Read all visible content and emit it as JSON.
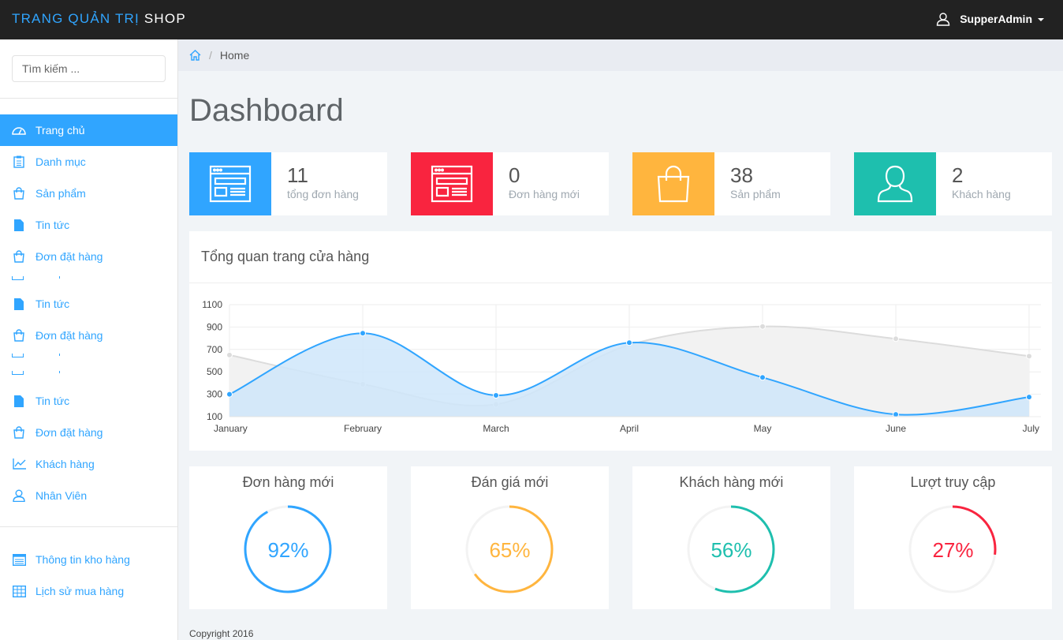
{
  "navbar": {
    "brand_part1": "TRANG QUẢN TRỊ",
    "brand_part2": "SHOP",
    "user_name": "SupperAdmin"
  },
  "sidebar": {
    "search_placeholder": "Tìm kiếm ...",
    "items": [
      {
        "label": "Trang chủ",
        "icon": "dashboard-icon",
        "active": true
      },
      {
        "label": "Danh mục",
        "icon": "clipboard-icon"
      },
      {
        "label": "Sản phẩm",
        "icon": "shopping-bag-icon"
      },
      {
        "label": "Tin tức",
        "icon": "file-icon"
      },
      {
        "label": "Đơn đặt hàng",
        "icon": "shopping-bag-icon"
      },
      {
        "label": "Tin tức",
        "icon": "file-icon"
      },
      {
        "label": "Đơn đặt hàng",
        "icon": "shopping-bag-icon"
      },
      {
        "label": "Tin tức",
        "icon": "file-icon"
      },
      {
        "label": "Đơn đặt hàng",
        "icon": "shopping-bag-icon"
      },
      {
        "label": "Khách hàng",
        "icon": "line-chart-icon"
      },
      {
        "label": "Nhân Viên",
        "icon": "user-icon"
      }
    ],
    "bottom_items": [
      {
        "label": "Thông tin kho hàng",
        "icon": "warehouse-list-icon"
      },
      {
        "label": "Lịch sử mua hàng",
        "icon": "table-icon"
      }
    ]
  },
  "breadcrumb": {
    "home_icon": "home-icon",
    "current": "Home"
  },
  "page_title": "Dashboard",
  "stats": [
    {
      "value": "11",
      "label": "tổng đơn hàng",
      "color": "#30a5ff",
      "icon": "browser-window-icon"
    },
    {
      "value": "0",
      "label": "Đơn hàng mới",
      "color": "#f9243f",
      "icon": "browser-window-icon"
    },
    {
      "value": "38",
      "label": "Sản phẩm",
      "color": "#ffb53e",
      "icon": "shopping-bag-icon"
    },
    {
      "value": "2",
      "label": "Khách hàng",
      "color": "#1ebfae",
      "icon": "user-icon"
    }
  ],
  "overview": {
    "title": "Tổng quan trang cửa hàng"
  },
  "chart_data": {
    "type": "area",
    "x": [
      "January",
      "February",
      "March",
      "April",
      "May",
      "June",
      "July"
    ],
    "ylim": [
      100,
      1100
    ],
    "yticks": [
      100,
      300,
      500,
      700,
      900,
      1100
    ],
    "grid": true,
    "series": [
      {
        "values": [
          650,
          390,
          210,
          740,
          905,
          795,
          640
        ],
        "color": "#dcdcdc",
        "fill": "#f2f2f2"
      },
      {
        "values": [
          300,
          845,
          290,
          760,
          450,
          120,
          275
        ],
        "color": "#30a5ff",
        "fill": "#cfe6fa"
      }
    ]
  },
  "progress": [
    {
      "title": "Đơn hàng mới",
      "value": 92,
      "label": "92%",
      "color": "#30a5ff"
    },
    {
      "title": "Đán giá mới",
      "value": 65,
      "label": "65%",
      "color": "#ffb53e"
    },
    {
      "title": "Khách hàng mới",
      "value": 56,
      "label": "56%",
      "color": "#1ebfae"
    },
    {
      "title": "Lượt truy cập",
      "value": 27,
      "label": "27%",
      "color": "#f9243f"
    }
  ],
  "footer": "Copyright 2016"
}
